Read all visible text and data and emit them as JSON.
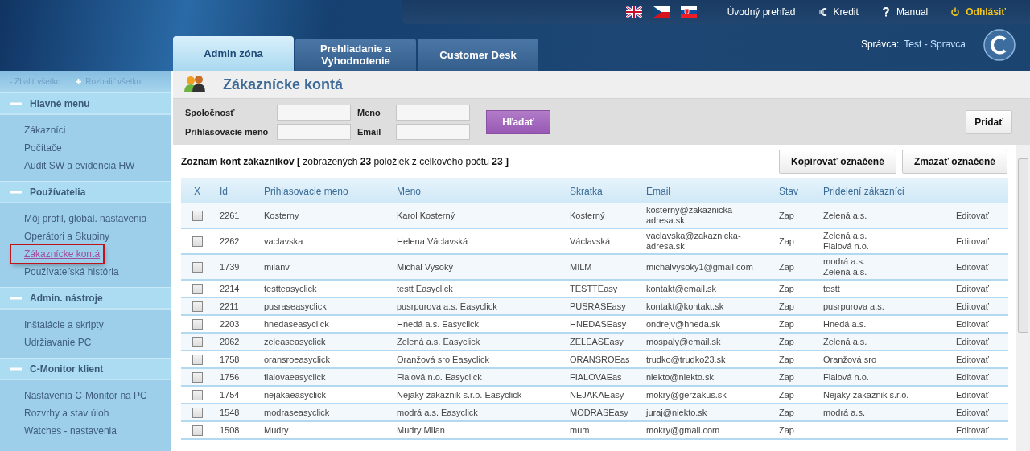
{
  "top_links": [
    {
      "kind": "home",
      "label": "Úvodný prehľad"
    },
    {
      "kind": "credit",
      "label": "Kredit"
    },
    {
      "kind": "help",
      "label": "Manual"
    },
    {
      "kind": "logout",
      "label": "Odhlásiť"
    }
  ],
  "tabs": [
    {
      "label": "Admin zóna",
      "selected": true
    },
    {
      "label": "Prehliadanie a Vyhodnotenie",
      "selected": false
    },
    {
      "label": "Customer Desk",
      "selected": false
    }
  ],
  "admin": {
    "label": "Správca:",
    "value": "Test - Spravca"
  },
  "sidebar": {
    "collapse": "- Zbaliť všetko",
    "expand": "Rozbaliť všetko",
    "sections": [
      {
        "title": "Hlavné menu",
        "expanded": true,
        "items": [
          {
            "label": "Zákazníci",
            "selected": false
          },
          {
            "label": "Počítače",
            "selected": false
          },
          {
            "label": "Audit SW a evidencia HW",
            "selected": false
          }
        ]
      },
      {
        "title": "Používatelia",
        "expanded": true,
        "items": [
          {
            "label": "Môj profil, globál. nastavenia",
            "selected": false
          },
          {
            "label": "Operátori a Skupiny",
            "selected": false
          },
          {
            "label": "Zákaznícke kontá",
            "selected": true
          },
          {
            "label": "Používateľská história",
            "selected": false
          }
        ]
      },
      {
        "title": "Admin. nástroje",
        "expanded": true,
        "items": [
          {
            "label": "Inštalácie a skripty",
            "selected": false
          },
          {
            "label": "Udržiavanie PC",
            "selected": false
          }
        ]
      },
      {
        "title": "C-Monitor klient",
        "expanded": true,
        "items": [
          {
            "label": "Nastavenia C-Monitor na PC",
            "selected": false
          },
          {
            "label": "Rozvrhy a stav úloh",
            "selected": false
          },
          {
            "label": "Watches - nastavenia",
            "selected": false
          }
        ]
      }
    ]
  },
  "page_title": "Zákaznícke kontá",
  "search": {
    "fields": [
      {
        "label": "Spoločnosť"
      },
      {
        "label": "Meno"
      },
      {
        "label": "Prihlasovacie meno"
      },
      {
        "label": "Email"
      }
    ],
    "search_button": "Hľadať",
    "add_button": "Pridať"
  },
  "list": {
    "summary": "**Zoznam kont zákazníkov [** zobrazených **23** položiek z celkového počtu **23 ]**",
    "copy_button": "Kopírovať označené",
    "delete_button": "Zmazať označené"
  },
  "table": {
    "columns": [
      "X",
      "Id",
      "Prihlasovacie meno",
      "Meno",
      "Skratka",
      "Email",
      "Stav",
      "Pridelení zákazníci"
    ],
    "rows": [
      {
        "checked": false,
        "id": "2261",
        "login": "Kosterny",
        "name": "Karol Kosterný",
        "short": "Kosterný",
        "email": "kosterny@zakaznicka-adresa.sk",
        "status": "Zap",
        "customers": [
          "Zelená a.s."
        ],
        "action": "Editovať"
      },
      {
        "checked": false,
        "id": "2262",
        "login": "vaclavska",
        "name": "Helena Václavská",
        "short": "Václavská",
        "email": "vaclavska@zakaznicka-adresa.sk",
        "status": "Zap",
        "customers": [
          "Zelená a.s.",
          "Fialová n.o."
        ],
        "action": "Editovať"
      },
      {
        "checked": false,
        "id": "1739",
        "login": "milanv",
        "name": "Michal Vysoký",
        "short": "MILM",
        "email": "michalvysoky1@gmail.com",
        "status": "Zap",
        "customers": [
          "modrá a.s.",
          "Zelená a.s."
        ],
        "action": "Editovať"
      },
      {
        "checked": false,
        "id": "2214",
        "login": "testteasyclick",
        "name": "testt Easyclick",
        "short": "TESTTEasy",
        "email": "kontakt@email.sk",
        "status": "Zap",
        "customers": [
          "testt"
        ],
        "action": "Editovať"
      },
      {
        "checked": false,
        "id": "2211",
        "login": "pusraseasyclick",
        "name": "pusrpurova a.s. Easyclick",
        "short": "PUSRASEasy",
        "email": "kontakt@kontakt.sk",
        "status": "Zap",
        "customers": [
          "pusrpurova a.s."
        ],
        "action": "Editovať"
      },
      {
        "checked": false,
        "id": "2203",
        "login": "hnedaseasyclick",
        "name": "Hnedá a.s. Easyclick",
        "short": "HNEDASEasy",
        "email": "ondrejv@hneda.sk",
        "status": "Zap",
        "customers": [
          "Hnedá a.s."
        ],
        "action": "Editovať"
      },
      {
        "checked": false,
        "id": "2062",
        "login": "zeleaseasyclick",
        "name": "Zelená a.s. Easyclick",
        "short": "ZELEASEasy",
        "email": "mospaly@email.sk",
        "status": "Zap",
        "customers": [
          "Zelená a.s."
        ],
        "action": "Editovať"
      },
      {
        "checked": false,
        "id": "1758",
        "login": "oransroeasyclick",
        "name": "Oranžová sro Easyclick",
        "short": "ORANSROEas",
        "email": "trudko@trudko23.sk",
        "status": "Zap",
        "customers": [
          "Oranžová sro"
        ],
        "action": "Editovať"
      },
      {
        "checked": false,
        "id": "1756",
        "login": "fialovaeasyclick",
        "name": "Fialová n.o. Easyclick",
        "short": "FIALOVAEas",
        "email": "niekto@niekto.sk",
        "status": "Zap",
        "customers": [
          "Fialová n.o."
        ],
        "action": "Editovať"
      },
      {
        "checked": false,
        "id": "1754",
        "login": "nejakaeasyclick",
        "name": "Nejaky zakaznik s.r.o. Easyclick",
        "short": "NEJAKAEasy",
        "email": "mokry@gerzakus.sk",
        "status": "Zap",
        "customers": [
          "Nejaky zakaznik s.r.o."
        ],
        "action": "Editovať"
      },
      {
        "checked": false,
        "id": "1548",
        "login": "modraseasyclick",
        "name": "modrá a.s. Easyclick",
        "short": "MODRASEasy",
        "email": "juraj@niekto.sk",
        "status": "Zap",
        "customers": [
          "modrá a.s."
        ],
        "action": "Editovať"
      },
      {
        "checked": false,
        "id": "1508",
        "login": "Mudry",
        "name": "Mudry Milan",
        "short": "mum",
        "email": "mokry@gmail.com",
        "status": "Zap",
        "customers": [],
        "action": "Editovať"
      }
    ]
  }
}
